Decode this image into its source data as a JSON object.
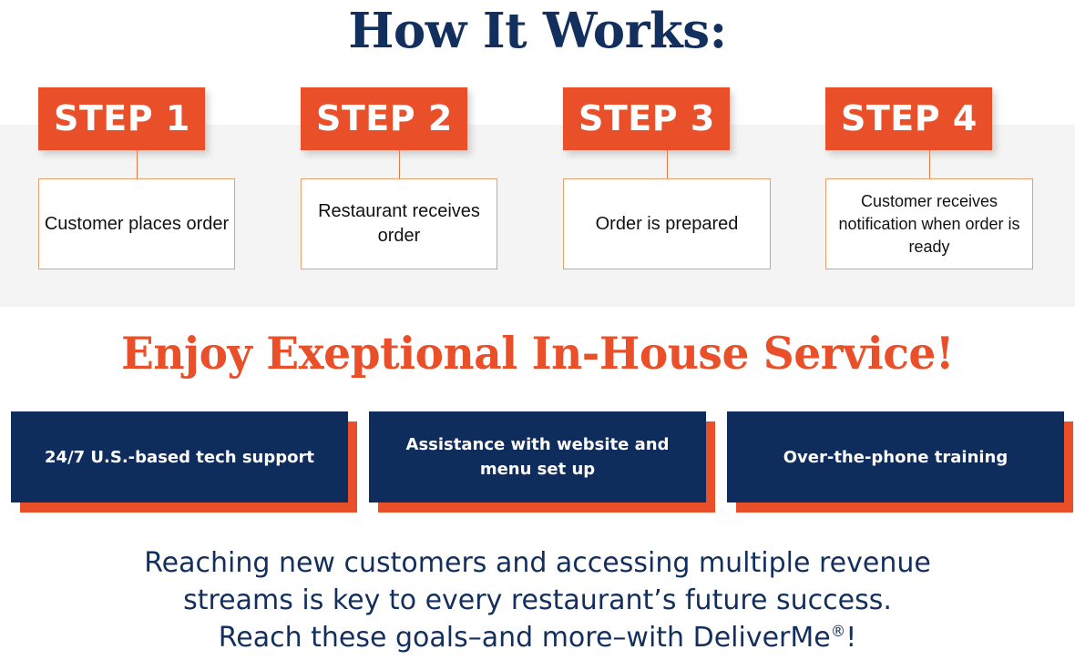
{
  "title": "How It Works:",
  "steps": [
    {
      "badge": "STEP 1",
      "description": "Customer places order"
    },
    {
      "badge": "STEP 2",
      "description": "Restaurant receives order"
    },
    {
      "badge": "STEP 3",
      "description": "Order is prepared"
    },
    {
      "badge": "STEP 4",
      "description": "Customer receives notification when order is ready"
    }
  ],
  "service": {
    "headline": "Enjoy Exeptional In-House Service!",
    "cards": [
      {
        "label": "24/7 U.S.-based tech support"
      },
      {
        "label": "Assistance with website and menu set up"
      },
      {
        "label": "Over-the-phone training"
      }
    ]
  },
  "closing": {
    "line1": "Reaching new customers and accessing multiple revenue",
    "line2": "streams is key to every restaurant’s future success.",
    "line3_before": "Reach these goals–and more–with DeliverMe",
    "line3_mark": "®",
    "line3_after": "!"
  },
  "colors": {
    "orange": "#e9502a",
    "navy": "#0f2d5c",
    "title_navy": "#132f5e",
    "band_grey": "#f4f4f4",
    "box_border": "#e4a071"
  }
}
